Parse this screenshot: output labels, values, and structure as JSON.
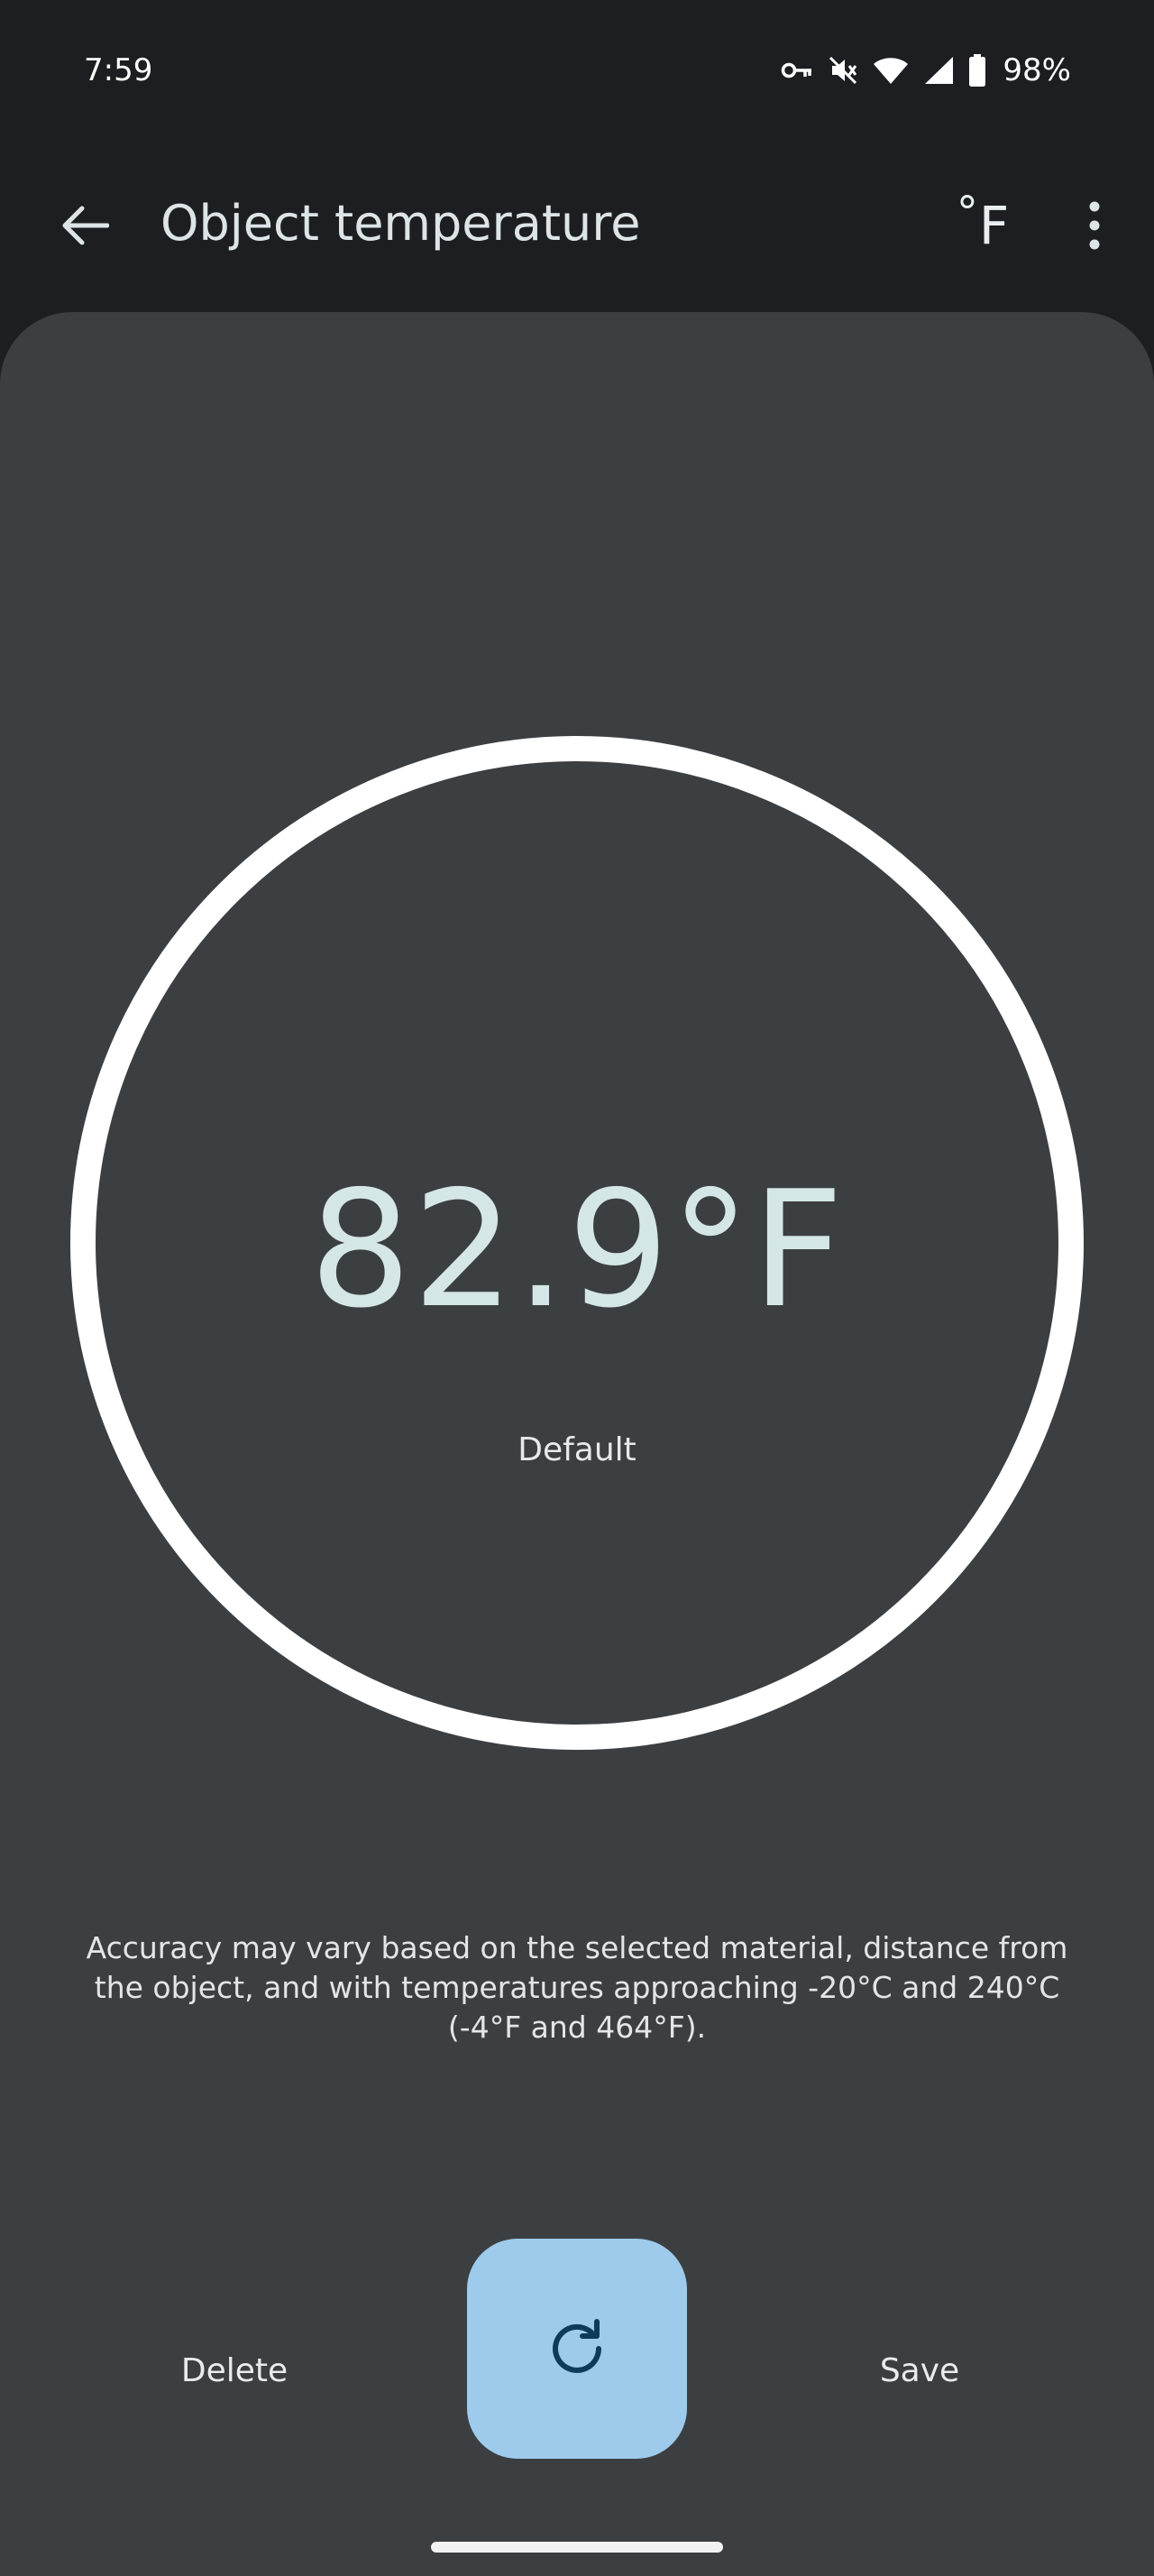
{
  "status_bar": {
    "time": "7:59",
    "battery_percent": "98%",
    "icons": [
      "vpn-key-icon",
      "vibrate-off-icon",
      "wifi-icon",
      "cell-signal-icon",
      "battery-icon"
    ]
  },
  "app_bar": {
    "title": "Object temperature",
    "back_icon": "arrow-back-icon",
    "unit_toggle": {
      "degree_symbol": "°",
      "unit_letter": "F"
    },
    "overflow_icon": "more-vert-icon"
  },
  "reading": {
    "temperature": "82.9°F",
    "material": "Default"
  },
  "accuracy_note": "Accuracy may vary based on the selected material, distance from the object, and with temperatures approaching -20°C and 240°C (-4°F and 464°F).",
  "actions": {
    "delete_label": "Delete",
    "save_label": "Save",
    "refresh_icon": "refresh-icon"
  },
  "colors": {
    "background": "#1c1e21",
    "card": "#3c3f42",
    "ring": "#ffffff",
    "temperature_text": "#d5e6e6",
    "refresh_button": "#9ecbec",
    "refresh_icon": "#0f3a5c"
  }
}
